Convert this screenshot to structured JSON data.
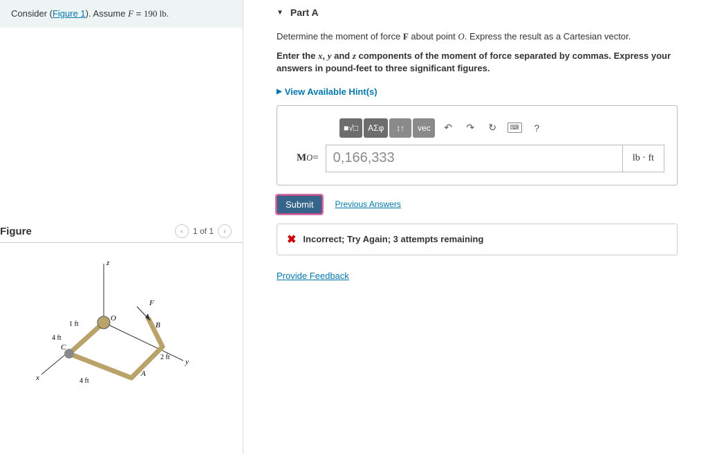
{
  "intro": {
    "prefix": "Consider (",
    "link": "Figure 1",
    "mid": "). Assume ",
    "Fsym": "F",
    "eq": " = ",
    "Fval": "190 lb",
    "suffix": "."
  },
  "figure": {
    "title": "Figure",
    "pager": "1 of 1",
    "labels": {
      "z": "z",
      "x": "x",
      "y": "y",
      "F": "F",
      "O": "O",
      "A": "A",
      "B": "B",
      "C": "C",
      "d1": "1 ft",
      "d4a": "4 ft",
      "d4b": "4 ft",
      "d2": "2 ft"
    }
  },
  "part": {
    "title": "Part A",
    "line1a": "Determine the moment of force ",
    "Fsym": "F",
    "line1b": " about point ",
    "Osym": "O",
    "line1c": ". Express the result as a Cartesian vector.",
    "line2a": "Enter the ",
    "xs": "x",
    "c1": ", ",
    "ys": "y",
    "and": " and ",
    "zs": "z",
    "line2b": " components of the moment of force separated by commas. Express your answers in pound-feet to three significant figures.",
    "hints": "View Available Hint(s)"
  },
  "toolbar": {
    "templates": "■√□",
    "greek": "ΑΣφ",
    "updown": "↕↑",
    "vec": "vec",
    "undo": "↶",
    "redo": "↷",
    "reset": "↻",
    "kbd": "⌨",
    "help": "?"
  },
  "answer": {
    "label_pre": "M",
    "label_sub": "O",
    "eq": " = ",
    "value": "0,166,333",
    "unit": "lb · ft"
  },
  "submit": {
    "button": "Submit",
    "prev": "Previous Answers"
  },
  "feedback": {
    "text": "Incorrect; Try Again; 3 attempts remaining"
  },
  "provide": "Provide Feedback"
}
